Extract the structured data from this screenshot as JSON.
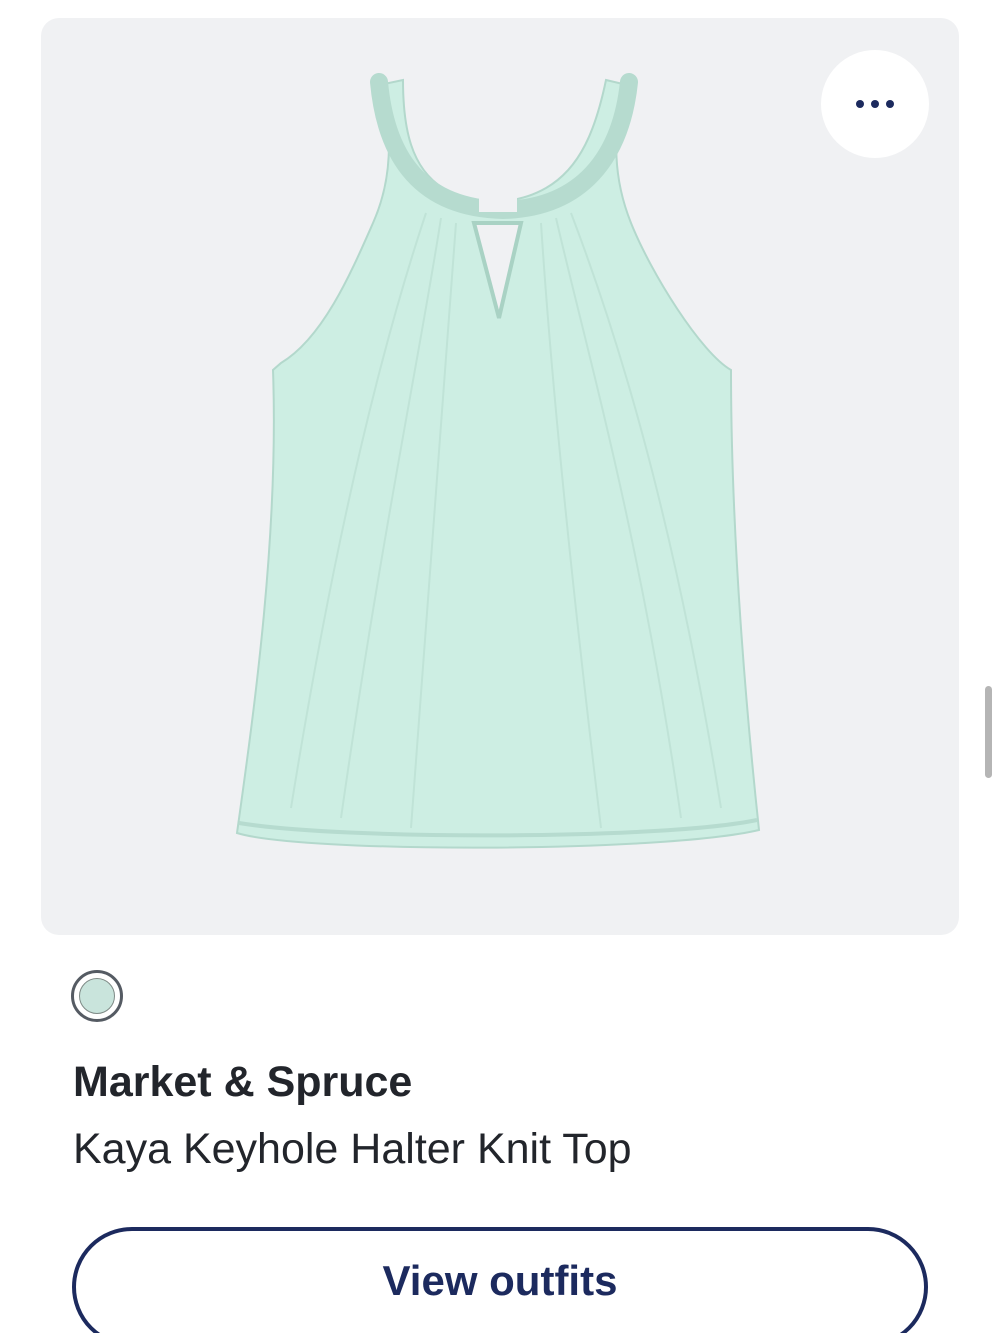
{
  "product": {
    "image_icon": "halter-top-image",
    "more_icon": "more-horizontal-icon",
    "swatch_color": "#c9e4dc",
    "garment_color": "#cdeee3",
    "brand": "Market & Spruce",
    "name": "Kaya Keyhole Halter Knit Top"
  },
  "actions": {
    "view_outfits_label": "View outfits"
  },
  "colors": {
    "accent": "#1c2a5e",
    "card_background": "#f0f1f3",
    "text": "#22252b"
  }
}
